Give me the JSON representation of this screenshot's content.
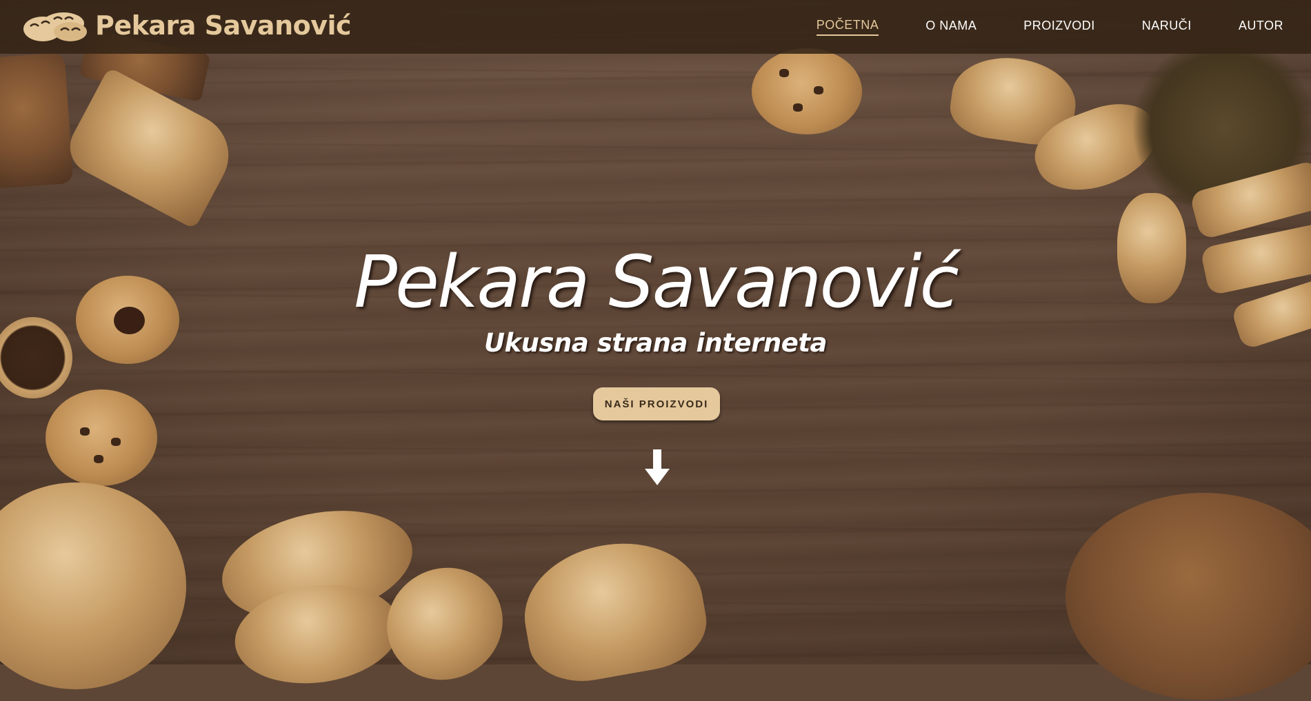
{
  "brand": {
    "name": "Pekara Savanović",
    "logo_icon": "bread-loaves-icon",
    "accent_color": "#e5c99c",
    "navbar_color": "#342416"
  },
  "nav": {
    "items": [
      {
        "label": "POČETNA",
        "active": true
      },
      {
        "label": "O NAMA",
        "active": false
      },
      {
        "label": "PROIZVODI",
        "active": false
      },
      {
        "label": "NARUČI",
        "active": false
      },
      {
        "label": "AUTOR",
        "active": false
      }
    ]
  },
  "hero": {
    "title": "Pekara Savanović",
    "subtitle": "Ukusna strana interneta",
    "cta_label": "NAŠI PROIZVODI",
    "scroll_icon": "arrow-down-icon"
  }
}
